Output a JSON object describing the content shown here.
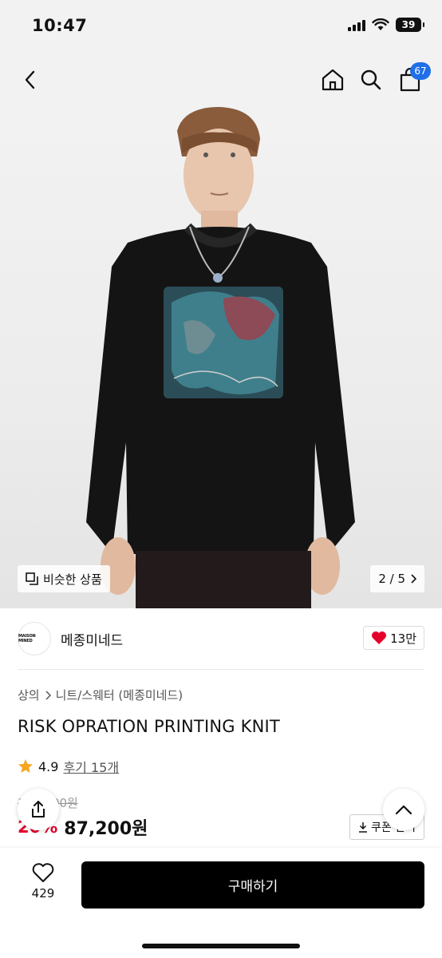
{
  "status": {
    "time": "10:47",
    "battery": "39"
  },
  "nav": {
    "cart_count": "67"
  },
  "hero": {
    "similar_label": "비슷한 상품",
    "pager": "2 / 5"
  },
  "brand": {
    "logo_text": "MAISON MINED",
    "name": "메종미네드",
    "likes": "13만"
  },
  "product": {
    "breadcrumb": [
      "상의",
      "니트/스웨터 (메종미네드)"
    ],
    "title": "RISK OPRATION PRINTING KNIT",
    "rating": "4.9",
    "reviews": "후기 15개",
    "original_price": "109,000원",
    "discount": "20%",
    "price": "87,200원",
    "coupon_label": "쿠폰 받기"
  },
  "bottom": {
    "wish_count": "429",
    "buy_label": "구매하기"
  },
  "colors": {
    "accent": "#1f6fe6",
    "discount": "#e4002b",
    "heart": "#e4002b",
    "star": "#f5a623"
  }
}
